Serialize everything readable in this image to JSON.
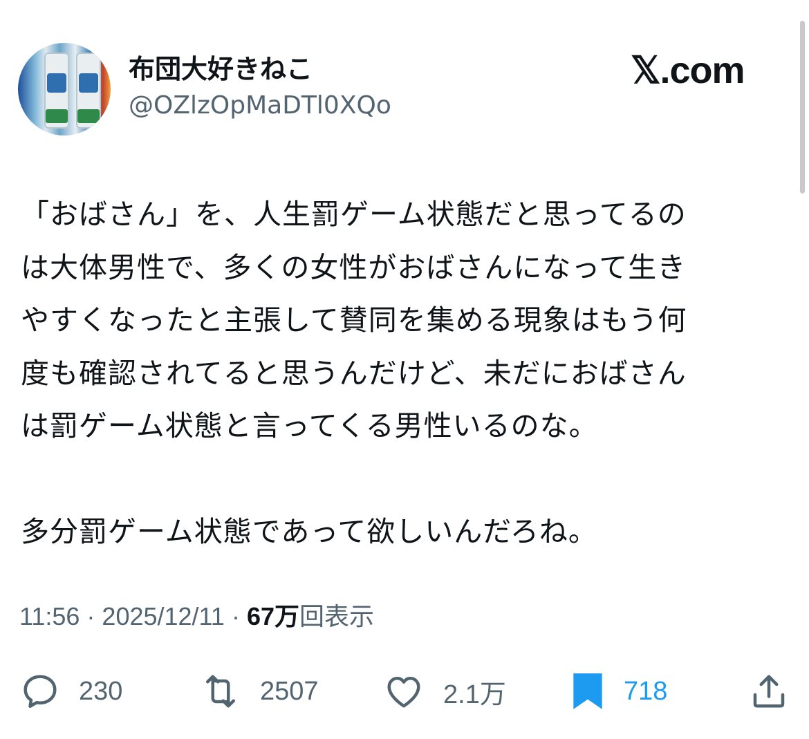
{
  "author": {
    "display_name": "布団大好きねこ",
    "handle": "@OZlzOpMaDTl0XQo",
    "avatar_icon": "avatar-photo"
  },
  "brand": "𝕏.com",
  "tweet": {
    "lines": [
      "「おばさん」を、人生罰ゲーム状態だと思ってるの",
      "は大体男性で、多くの女性がおばさんになって生き",
      "やすくなったと主張して賛同を集める現象はもう何",
      "度も確認されてると思うんだけど、未だにおばさん",
      "は罰ゲーム状態と言ってくる男性いるのな。",
      "",
      "多分罰ゲーム状態であって欲しいんだろね。"
    ]
  },
  "meta": {
    "time": "11:56",
    "separator": " · ",
    "date": "2025/12/11",
    "views_count": "67万",
    "views_label": "回表示"
  },
  "actions": {
    "reply": {
      "icon": "reply-icon",
      "count": "230"
    },
    "repost": {
      "icon": "repost-icon",
      "count": "2507"
    },
    "like": {
      "icon": "heart-icon",
      "count": "2.1万"
    },
    "bookmark": {
      "icon": "bookmark-icon",
      "count": "718",
      "active_color": "#1d9bf0"
    },
    "share": {
      "icon": "share-icon"
    }
  }
}
